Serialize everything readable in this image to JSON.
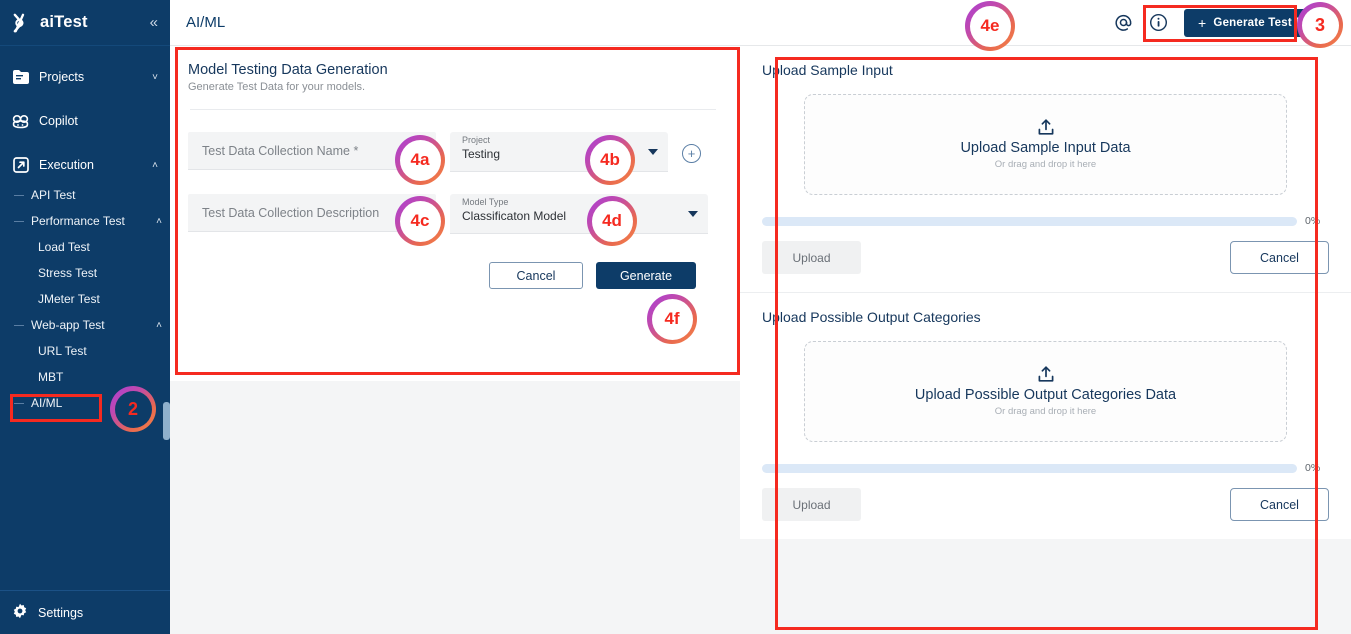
{
  "brand": {
    "name": "aiTest",
    "collapse_icon": "chevron-double-left-icon"
  },
  "sidebar": {
    "top_items": [
      {
        "label": "Projects",
        "icon": "folder-icon",
        "chevron": "˅"
      },
      {
        "label": "Copilot",
        "icon": "copilot-icon",
        "chevron": ""
      },
      {
        "label": "Execution",
        "icon": "external-link-icon",
        "chevron": "˄"
      }
    ],
    "sub_items": [
      {
        "label": "API Test",
        "indent": false,
        "chevron": ""
      },
      {
        "label": "Performance Test",
        "indent": false,
        "chevron": "˄"
      },
      {
        "label": "Load Test",
        "indent": true,
        "chevron": ""
      },
      {
        "label": "Stress Test",
        "indent": true,
        "chevron": ""
      },
      {
        "label": "JMeter Test",
        "indent": true,
        "chevron": ""
      },
      {
        "label": "Web-app Test",
        "indent": false,
        "chevron": "˄"
      },
      {
        "label": "URL Test",
        "indent": true,
        "chevron": ""
      },
      {
        "label": "MBT",
        "indent": true,
        "chevron": ""
      },
      {
        "label": "AI/ML",
        "indent": false,
        "chevron": ""
      }
    ],
    "footer": {
      "label": "Settings",
      "icon": "gear-icon"
    }
  },
  "topbar": {
    "title": "AI/ML",
    "mention_icon": "at-sign-icon",
    "info_icon": "info-circle-icon",
    "generate_button": {
      "label": "Generate Test Data",
      "plus": "+"
    }
  },
  "form": {
    "title": "Model Testing Data Generation",
    "subtitle": "Generate Test Data for your models.",
    "name_placeholder": "Test Data Collection Name *",
    "description_placeholder": "Test Data Collection Description",
    "project": {
      "label": "Project",
      "value": "Testing"
    },
    "model_type": {
      "label": "Model Type",
      "value": "Classificaton Model"
    },
    "add_project_icon": "plus-circle-icon",
    "cancel_label": "Cancel",
    "generate_label": "Generate"
  },
  "uploads": [
    {
      "title": "Upload Sample Input",
      "dropzone_icon": "upload-icon",
      "dropzone_main": "Upload Sample Input Data",
      "dropzone_sub": "Or drag and drop it here",
      "progress_pct": "0%",
      "upload_label": "Upload",
      "cancel_label": "Cancel"
    },
    {
      "title": "Upload Possible Output Categories",
      "dropzone_icon": "upload-icon",
      "dropzone_main": "Upload Possible Output Categories Data",
      "dropzone_sub": "Or drag and drop it here",
      "progress_pct": "0%",
      "upload_label": "Upload",
      "cancel_label": "Cancel"
    }
  ],
  "annotations": {
    "markers": [
      {
        "id": "m2",
        "label": "2"
      },
      {
        "id": "m3",
        "label": "3"
      },
      {
        "id": "m4a",
        "label": "4a"
      },
      {
        "id": "m4b",
        "label": "4b"
      },
      {
        "id": "m4c",
        "label": "4c"
      },
      {
        "id": "m4d",
        "label": "4d"
      },
      {
        "id": "m4e",
        "label": "4e"
      },
      {
        "id": "m4f",
        "label": "4f"
      }
    ],
    "colors": {
      "box": "#f52a20",
      "text": "#f52a20",
      "ring_start": "#a93fd6",
      "ring_end": "#f5854a"
    }
  },
  "colors": {
    "sidebar_bg": "#0d3c68",
    "accent": "#0d3c68",
    "page_bg": "#f4f5f6",
    "progress_track": "#dbe8f7"
  }
}
